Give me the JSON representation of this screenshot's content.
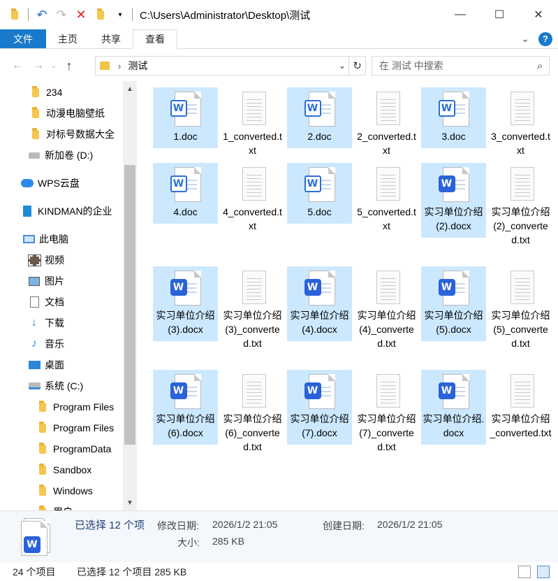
{
  "window": {
    "path_title": "C:\\Users\\Administrator\\Desktop\\测试"
  },
  "ribbon": {
    "tabs": [
      "文件",
      "主页",
      "共享",
      "查看"
    ],
    "active_tab": "查看"
  },
  "address": {
    "crumb": "测试",
    "search_placeholder": "在 测试 中搜索"
  },
  "sidebar": {
    "items": [
      {
        "label": "234",
        "icon": "folder-icon"
      },
      {
        "label": "动漫电脑壁纸",
        "icon": "folder-icon"
      },
      {
        "label": "对标号数据大全",
        "icon": "folder-icon"
      },
      {
        "label": "新加卷 (D:)",
        "icon": "drive-icon"
      },
      {
        "label": "WPS云盘",
        "icon": "cloud-icon"
      },
      {
        "label": "KINDMAN的企业",
        "icon": "enterprise-icon"
      },
      {
        "label": "此电脑",
        "icon": "computer-icon"
      },
      {
        "label": "视频",
        "icon": "video-icon"
      },
      {
        "label": "图片",
        "icon": "picture-icon"
      },
      {
        "label": "文档",
        "icon": "document-icon"
      },
      {
        "label": "下载",
        "icon": "download-icon"
      },
      {
        "label": "音乐",
        "icon": "music-icon"
      },
      {
        "label": "桌面",
        "icon": "desktop-icon"
      },
      {
        "label": "系统 (C:)",
        "icon": "system-drive-icon"
      },
      {
        "label": "Program Files",
        "icon": "folder-icon"
      },
      {
        "label": "Program Files",
        "icon": "folder-icon"
      },
      {
        "label": "ProgramData",
        "icon": "folder-icon"
      },
      {
        "label": "Sandbox",
        "icon": "folder-icon"
      },
      {
        "label": "Windows",
        "icon": "folder-icon"
      },
      {
        "label": "用户",
        "icon": "folder-icon"
      }
    ]
  },
  "files": [
    {
      "name": "1.doc",
      "type": "doc",
      "selected": true
    },
    {
      "name": "1_converted.txt",
      "type": "txt",
      "selected": false
    },
    {
      "name": "2.doc",
      "type": "doc",
      "selected": true
    },
    {
      "name": "2_converted.txt",
      "type": "txt",
      "selected": false
    },
    {
      "name": "3.doc",
      "type": "doc",
      "selected": true
    },
    {
      "name": "3_converted.txt",
      "type": "txt",
      "selected": false
    },
    {
      "name": "4.doc",
      "type": "doc",
      "selected": true
    },
    {
      "name": "4_converted.txt",
      "type": "txt",
      "selected": false
    },
    {
      "name": "5.doc",
      "type": "doc",
      "selected": true
    },
    {
      "name": "5_converted.txt",
      "type": "txt",
      "selected": false
    },
    {
      "name": "实习单位介绍 (2).docx",
      "type": "docx",
      "selected": true
    },
    {
      "name": "实习单位介绍(2)_converted.txt",
      "type": "txt",
      "selected": false
    },
    {
      "name": "实习单位介绍 (3).docx",
      "type": "docx",
      "selected": true
    },
    {
      "name": "实习单位介绍(3)_converted.txt",
      "type": "txt",
      "selected": false
    },
    {
      "name": "实习单位介绍 (4).docx",
      "type": "docx",
      "selected": true
    },
    {
      "name": "实习单位介绍(4)_converted.txt",
      "type": "txt",
      "selected": false
    },
    {
      "name": "实习单位介绍 (5).docx",
      "type": "docx",
      "selected": true
    },
    {
      "name": "实习单位介绍(5)_converted.txt",
      "type": "txt",
      "selected": false
    },
    {
      "name": "实习单位介绍 (6).docx",
      "type": "docx",
      "selected": true
    },
    {
      "name": "实习单位介绍(6)_converted.txt",
      "type": "txt",
      "selected": false
    },
    {
      "name": "实习单位介绍 (7).docx",
      "type": "docx",
      "selected": true
    },
    {
      "name": "实习单位介绍(7)_converted.txt",
      "type": "txt",
      "selected": false
    },
    {
      "name": "实习单位介绍.docx",
      "type": "docx",
      "selected": true
    },
    {
      "name": "实习单位介绍_converted.txt",
      "type": "txt",
      "selected": false
    }
  ],
  "details": {
    "selection": "已选择 12 个项",
    "modified_label": "修改日期:",
    "modified_value": "2026/1/2 21:05",
    "created_label": "创建日期:",
    "created_value": "2026/1/2 21:05",
    "size_label": "大小:",
    "size_value": "285 KB"
  },
  "status": {
    "count": "24 个项目",
    "selection": "已选择 12 个项目  285 KB"
  },
  "colors": {
    "selection_bg": "#cce8ff",
    "file_tab": "#1979ca",
    "word_blue": "#2a62d9"
  }
}
